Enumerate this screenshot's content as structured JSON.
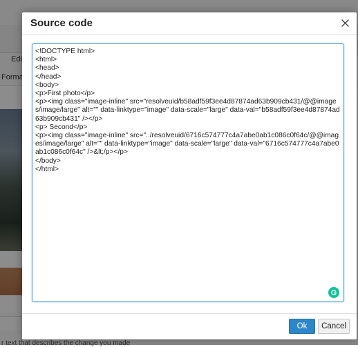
{
  "background": {
    "edit_tab": "Edi",
    "format_tab": "Forma",
    "help_text": "r text that describes the change you made"
  },
  "modal": {
    "title": "Source code",
    "source": "<!DOCTYPE html>\n<html>\n<head>\n</head>\n<body>\n<p>First photo</p>\n<p><img class=\"image-inline\" src=\"resolveuid/b58adf59f3ee4d87874ad63b909cb431/@@images/image/large\" alt=\"\" data-linktype=\"image\" data-scale=\"large\" data-val=\"b58adf59f3ee4d87874ad63b909cb431\" /></p>\n<p> Second</p>\n<p><img class=\"image-inline\" src=\"../resolveuid/6716c574777c4a7abe0ab1c086c0f64c/@@images/image/large\" alt=\"\" data-linktype=\"image\" data-scale=\"large\" data-val=\"6716c574777c4a7abe0ab1c086c0f64c\" />&lt;/p></p>\n</body>\n</html>",
    "ok_label": "Ok",
    "cancel_label": "Cancel"
  },
  "icons": {
    "close": "close-icon",
    "grammarly": "grammarly-icon"
  },
  "colors": {
    "ok_button": "#2d86c7",
    "focus_border": "#4a9ad6",
    "grammarly": "#15c39a"
  }
}
